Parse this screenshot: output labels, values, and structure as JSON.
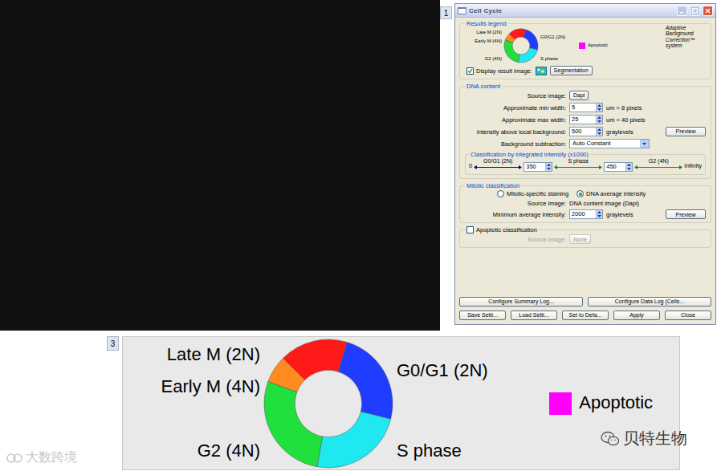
{
  "figure_labels": {
    "top": "1",
    "bottom": "3"
  },
  "window": {
    "title": "Cell Cycle"
  },
  "results_legend": {
    "title": "Results legend",
    "phases": [
      {
        "label": "Late M (2N)",
        "color": "#ff1a1a"
      },
      {
        "label": "Early M (4N)",
        "color": "#ff8a1f"
      },
      {
        "label": "G0/G1 (2N)",
        "color": "#1f3cff"
      },
      {
        "label": "G2 (4N)",
        "color": "#1fe03c"
      },
      {
        "label": "S phase",
        "color": "#1fe8f0"
      }
    ],
    "apoptotic": {
      "label": "Apoptotic",
      "color": "#ff00ff"
    },
    "brand": "Adaptive Background Correction™ system",
    "display_result_image": {
      "label": "Display result image:",
      "checked": true
    },
    "segmentation_button": "Segmentation"
  },
  "dna_content": {
    "title": "DNA content",
    "source_image": {
      "label": "Source image:",
      "value": "Dapi"
    },
    "fields": [
      {
        "label": "Approximate min width:",
        "value": "5",
        "unit": "um = 8 pixels",
        "button": ""
      },
      {
        "label": "Approximate max width:",
        "value": "25",
        "unit": "um = 40 pixels",
        "button": ""
      },
      {
        "label": "Intensity above local background:",
        "value": "500",
        "unit": "graylevels",
        "button": "Preview"
      }
    ],
    "background_subtraction": {
      "label": "Background subtraction:",
      "value": "Auto Constant"
    },
    "classification": {
      "title": "Classification by integrated intensity (x1000)",
      "start": "0",
      "end": "Infinity",
      "ranges": [
        {
          "label": "G0/G1 (2N)",
          "color": "#000080"
        },
        {
          "label": "S phase",
          "color": "#1a7a1a"
        },
        {
          "label": "G2 (4N)",
          "color": "#1a7a1a"
        }
      ],
      "thresholds": [
        "350",
        "450"
      ]
    }
  },
  "mitotic": {
    "title": "Mitotic classification",
    "options": [
      {
        "label": "Mitotic-specific staining",
        "selected": false
      },
      {
        "label": "DNA average intensity",
        "selected": true
      }
    ],
    "source_image": {
      "label": "Source image:",
      "value": "DNA content image (Dapi)"
    },
    "minimum": {
      "label": "Minimum average intensity:",
      "value": "2000",
      "unit": "graylevels",
      "button": "Preview"
    }
  },
  "apoptotic_classification": {
    "label": "Apoptotic classification",
    "checked": false,
    "source_image": {
      "label": "Source image:",
      "value": "None",
      "disabled": true
    }
  },
  "buttons": [
    [
      "Configure Summary Log...",
      "Configure Data Log (Cells..."
    ],
    [
      "Save Setti...",
      "Load Setti...",
      "Set to Defa...",
      "Apply",
      "Close"
    ]
  ],
  "watermarks": [
    {
      "text": "大数跨境"
    },
    {
      "text": "贝特生物"
    }
  ]
}
